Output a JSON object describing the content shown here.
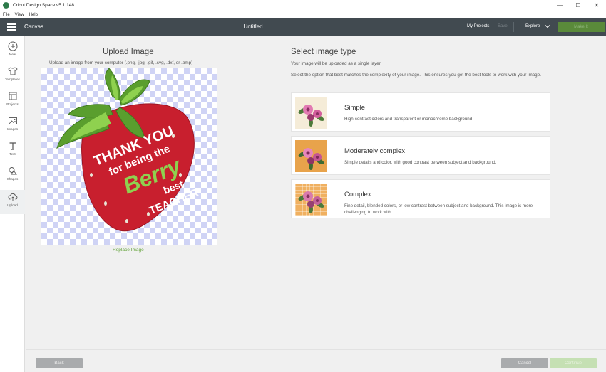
{
  "window": {
    "title": "Cricut Design Space  v5.1.148",
    "controls": {
      "minimize": "—",
      "maximize": "☐",
      "close": "✕"
    }
  },
  "menu": [
    "File",
    "View",
    "Help"
  ],
  "header": {
    "section": "Canvas",
    "document_title": "Untitled",
    "my_projects": "My Projects",
    "save": "Save",
    "explore": "Explore",
    "make_it": "Make It",
    "colors": {
      "bar": "#414a50",
      "make_it": "#5a8a3a"
    }
  },
  "sidebar": {
    "items": [
      {
        "label": "New",
        "icon": "plus-circle-icon"
      },
      {
        "label": "Templates",
        "icon": "shirt-icon"
      },
      {
        "label": "Projects",
        "icon": "projects-icon"
      },
      {
        "label": "Images",
        "icon": "image-icon"
      },
      {
        "label": "Text",
        "icon": "text-icon"
      },
      {
        "label": "Shapes",
        "icon": "shapes-icon"
      },
      {
        "label": "Upload",
        "icon": "upload-icon",
        "active": true
      }
    ]
  },
  "upload": {
    "title": "Upload Image",
    "subtitle": "Upload an image from your computer (.png, .jpg, .gif, .svg, .dxf, or .bmp)",
    "replace_link": "Replace Image",
    "artwork_text": [
      "THANK YOU",
      "for being the",
      "Berry",
      "best",
      "TEACHER"
    ]
  },
  "image_type": {
    "title": "Select image type",
    "note": "Your image will be uploaded as a single layer",
    "description": "Select the option that best matches the complexity of your image. This ensures you get the best tools to work with your image.",
    "options": [
      {
        "title": "Simple",
        "description": "High-contrast colors and transparent or monochrome background",
        "thumb_bg": "#f5ecd8"
      },
      {
        "title": "Moderately complex",
        "description": "Simple details and color, with good contrast between subject and background.",
        "thumb_bg": "#e8a34b"
      },
      {
        "title": "Complex",
        "description": "Fine detail, blended colors, or low contrast between subject and background. This image is more challenging to work with.",
        "thumb_bg": "#f0b060"
      }
    ]
  },
  "footer": {
    "back": "Back",
    "cancel": "Cancel",
    "continue": "Continue"
  }
}
